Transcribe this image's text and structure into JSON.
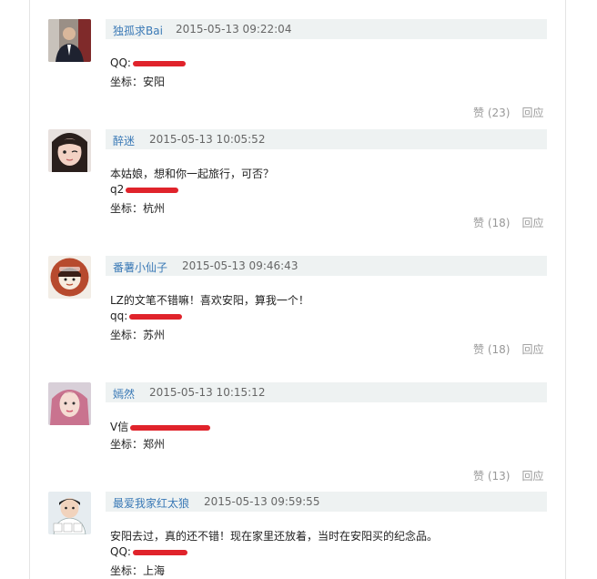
{
  "comments": [
    {
      "username": "独孤求Bai",
      "time": "2015-05-13 09:22:04",
      "lines": [
        {
          "prefix": "QQ:",
          "redacted": true
        },
        {
          "prefix": "坐标：安阳",
          "redacted": false
        }
      ],
      "like_label": "赞",
      "like_count": "(23)",
      "reply_label": "回应"
    },
    {
      "username": "醉迷",
      "time": "2015-05-13 10:05:52",
      "lines": [
        {
          "prefix": "本姑娘，想和你一起旅行，可否？",
          "redacted": false
        },
        {
          "prefix": "q2",
          "redacted": true
        },
        {
          "prefix": "坐标：杭州",
          "redacted": false
        }
      ],
      "like_label": "赞",
      "like_count": "(18)",
      "reply_label": "回应"
    },
    {
      "username": "番薯小仙子",
      "time": "2015-05-13 09:46:43",
      "lines": [
        {
          "prefix": "LZ的文笔不错嘛！喜欢安阳，算我一个！",
          "redacted": false
        },
        {
          "prefix": "qq:",
          "redacted": true
        },
        {
          "prefix": "坐标：苏州",
          "redacted": false
        }
      ],
      "like_label": "赞",
      "like_count": "(18)",
      "reply_label": "回应"
    },
    {
      "username": "嫣然",
      "time": "2015-05-13 10:15:12",
      "lines": [
        {
          "prefix": "V信",
          "redacted": true
        },
        {
          "prefix": "坐标：郑州",
          "redacted": false
        }
      ],
      "like_label": "赞",
      "like_count": "(13)",
      "reply_label": "回应"
    },
    {
      "username": "最爱我家红太狼",
      "time": "2015-05-13 09:59:55",
      "lines": [
        {
          "prefix": "安阳去过，真的还不错！现在家里还放着，当时在安阳买的纪念品。",
          "redacted": false
        },
        {
          "prefix": "QQ:",
          "redacted": true
        },
        {
          "prefix": "坐标：上海",
          "redacted": false
        }
      ],
      "like_label": "",
      "like_count": "",
      "reply_label": ""
    }
  ],
  "colors": {
    "username": "#3a79b6",
    "header_bg": "#eef2f2",
    "redaction": "#e0232b",
    "muted": "#999999"
  },
  "avatar_icons": [
    "avatar-man-suit",
    "avatar-girl-winking",
    "avatar-cartoon-girl",
    "avatar-woman-pink-hair",
    "avatar-boy"
  ]
}
